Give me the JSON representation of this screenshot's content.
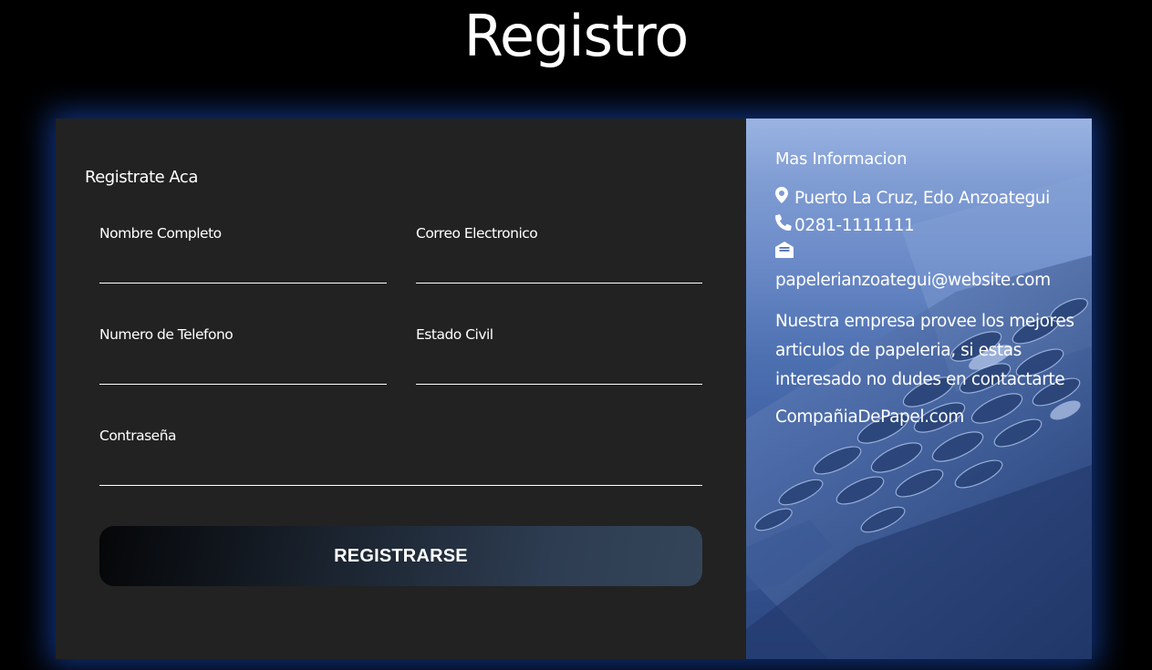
{
  "page": {
    "title": "Registro"
  },
  "form": {
    "heading": "Registrate Aca",
    "fields": [
      {
        "label": "Nombre Completo",
        "value": ""
      },
      {
        "label": "Correo Electronico",
        "value": ""
      },
      {
        "label": "Numero de Telefono",
        "value": ""
      },
      {
        "label": "Estado Civil",
        "value": ""
      },
      {
        "label": "Contraseña",
        "value": ""
      }
    ],
    "submit_label": "REGISTRARSE"
  },
  "info": {
    "title": "Mas Informacion",
    "location": "Puerto La Cruz, Edo Anzoategui",
    "phone": "0281-1111111",
    "email": "papelerianzoategui@website.com",
    "description": "Nuestra empresa provee los mejores articulos de papeleria, si estas interesado no dudes en contactarte",
    "website": "CompañiaDePapel.com",
    "icons": {
      "location": "map-marker-icon",
      "phone": "phone-icon",
      "email": "envelope-open-icon"
    }
  },
  "colors": {
    "background": "#000000",
    "form_panel": "#222222",
    "glow": "#1e5adc",
    "info_panel_top": "#9ab3e2",
    "info_panel_bottom": "#2c4780"
  }
}
